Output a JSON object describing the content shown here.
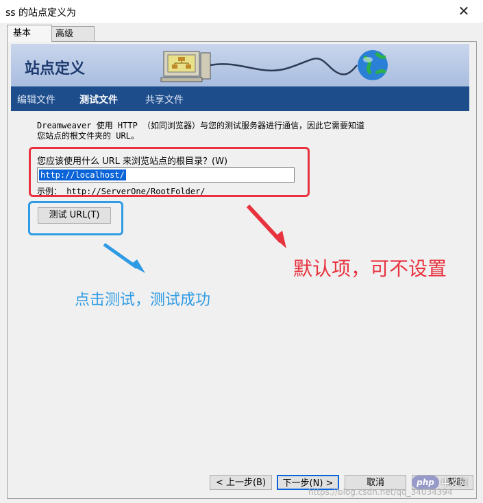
{
  "window": {
    "title": "ss 的站点定义为",
    "close_glyph": "✕"
  },
  "tabs": [
    {
      "label": "基本"
    },
    {
      "label": "高级"
    }
  ],
  "header": {
    "title": "站点定义"
  },
  "nav": [
    {
      "label": "编辑文件"
    },
    {
      "label": "测试文件"
    },
    {
      "label": "共享文件"
    }
  ],
  "content": {
    "description_line1": "Dreamweaver 使用 HTTP （如同浏览器）与您的测试服务器进行通信，因此它需要知道",
    "description_line2": "您站点的根文件夹的 URL。",
    "url_question": "您应该使用什么 URL 来浏览站点的根目录？(W)",
    "url_value": "http://localhost/",
    "example": "示例： http://ServerOne/RootFolder/",
    "test_button": "测试 URL(T)"
  },
  "annotations": {
    "red_text": "默认项，可不设置",
    "blue_text": "点击测试，测试成功",
    "red_color": "#e8333f",
    "blue_color": "#2f9be4"
  },
  "footer": {
    "back": "< 上一步(B)",
    "next": "下一步(N) >",
    "cancel": "取消",
    "help": "帮助",
    "watermark_php": "php",
    "watermark_suffix": "中文网",
    "watermark_url": "https://blog.csdn.net/qq_34034394"
  },
  "icons": [
    "close-icon",
    "computer-icon",
    "globe-icon",
    "cable-icon",
    "arrow-icon"
  ]
}
